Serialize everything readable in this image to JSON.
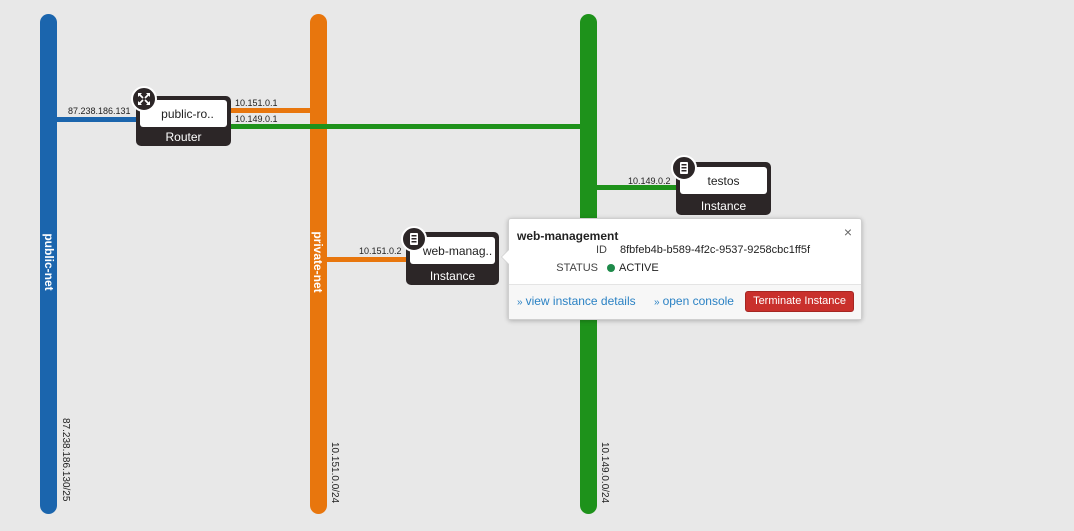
{
  "colors": {
    "public_net": "#1b65ad",
    "private_net": "#e8760d",
    "green_net": "#1e921b",
    "device_bg": "#2c2627",
    "status_active": "#1e8a4a",
    "danger": "#c9302c"
  },
  "networks": {
    "public": {
      "name": "public-net",
      "cidr": "87.238.186.130/25"
    },
    "private": {
      "name": "private-net",
      "cidr": "10.151.0.0/24"
    },
    "green": {
      "name": "",
      "cidr": "10.149.0.0/24"
    }
  },
  "ports": {
    "router_public": "87.238.186.131",
    "router_private": "10.151.0.1",
    "router_green": "10.149.0.1",
    "testos_green": "10.149.0.2",
    "web_private": "10.151.0.2"
  },
  "devices": {
    "router": {
      "name": "public-ro..",
      "type": "Router",
      "icon": "router-icon"
    },
    "testos": {
      "name": "testos",
      "type": "Instance",
      "icon": "instance-icon"
    },
    "web": {
      "name": "web-manag..",
      "type": "Instance",
      "icon": "instance-icon"
    }
  },
  "popup": {
    "title": "web-management",
    "id_label": "ID",
    "id_value": "8fbfeb4b-b589-4f2c-9537-9258cbc1ff5f",
    "status_label": "STATUS",
    "status_value": "ACTIVE",
    "close": "×",
    "view_details": "view instance details",
    "open_console": "open console",
    "terminate": "Terminate Instance"
  }
}
